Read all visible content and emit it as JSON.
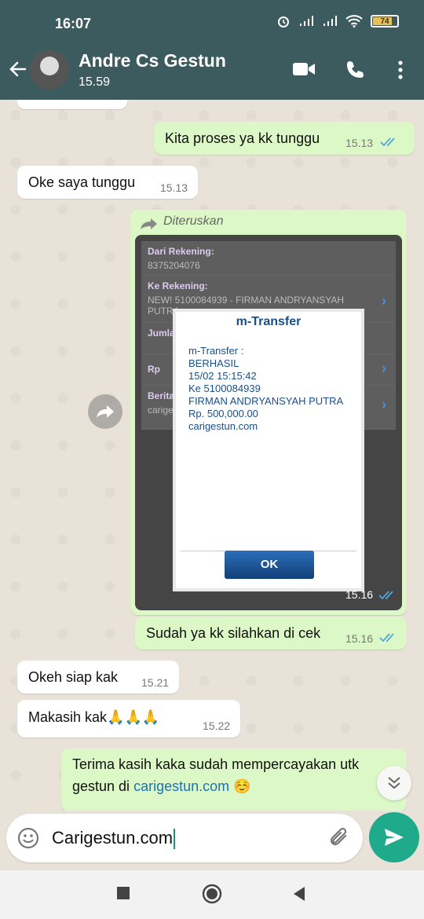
{
  "status_bar": {
    "time": "16:07",
    "battery_level": "74"
  },
  "header": {
    "contact_name": "Andre Cs Gestun",
    "last_seen": "15.59"
  },
  "messages": [
    {
      "type": "out",
      "text": "Kita proses ya kk tunggu",
      "time": "15.13",
      "ticks": "read"
    },
    {
      "type": "in",
      "text": "Oke saya tunggu",
      "time": "15.13"
    },
    {
      "type": "out-image",
      "forwarded_label": "Diteruskan",
      "time": "15.16",
      "ticks": "read"
    },
    {
      "type": "out",
      "text": "Sudah ya kk silahkan di cek",
      "time": "15.16",
      "ticks": "read"
    },
    {
      "type": "in",
      "text": "Okeh siap kak",
      "time": "15.21"
    },
    {
      "type": "in",
      "text": "Makasih kak🙏🙏🙏",
      "time": "15.22"
    },
    {
      "type": "out",
      "text_line1": "Terima kasih kaka sudah mempercayakan utk",
      "text_line2_prefix": "gestun di ",
      "text_line2_link": "carigestun.com",
      "text_line2_emoji": "☺️"
    }
  ],
  "transfer_screenshot": {
    "rows": [
      {
        "label": "Dari Rekening:",
        "value": "8375204076"
      },
      {
        "label": "Ke Rekening:",
        "value": "NEW! 5100084939 - FIRMAN ANDRYANSYAH",
        "value2": "PUTRA"
      },
      {
        "label": "Jumla",
        "value": ""
      },
      {
        "label": "Rp",
        "value": ""
      },
      {
        "label": "Berita",
        "value": "carige"
      }
    ],
    "dialog": {
      "title": "m-Transfer",
      "lines": [
        "m-Transfer :",
        "BERHASIL",
        "15/02 15:15:42",
        "Ke 5100084939",
        "FIRMAN ANDRYANSYAH PUTRA",
        "Rp. 500,000.00",
        "carigestun.com"
      ],
      "ok_label": "OK"
    }
  },
  "composer": {
    "text": "Carigestun.com"
  },
  "colors": {
    "header": "#3b5b5f",
    "outgoing_bubble": "#dcf8c6",
    "send_button": "#1faa8b",
    "read_ticks": "#4fa6e0"
  }
}
